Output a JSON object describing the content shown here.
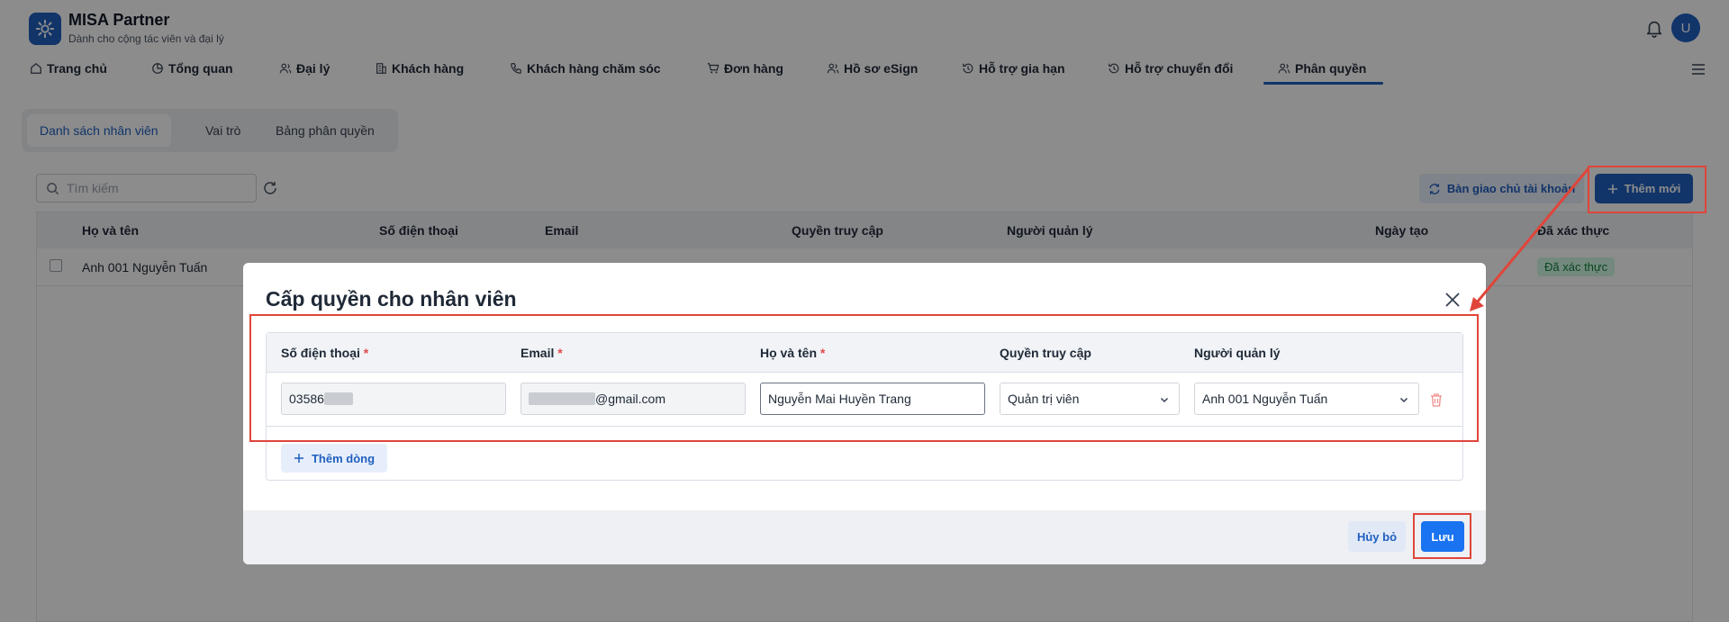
{
  "app": {
    "title": "MISA Partner",
    "subtitle": "Dành cho cộng tác viên và đại lý",
    "avatar_letter": "U"
  },
  "nav": {
    "items": [
      {
        "label": "Trang chủ",
        "icon": "home-icon"
      },
      {
        "label": "Tổng quan",
        "icon": "pie-chart-icon"
      },
      {
        "label": "Đại lý",
        "icon": "users-icon"
      },
      {
        "label": "Khách hàng",
        "icon": "building-icon"
      },
      {
        "label": "Khách hàng chăm sóc",
        "icon": "phone-icon"
      },
      {
        "label": "Đơn hàng",
        "icon": "cart-icon"
      },
      {
        "label": "Hồ sơ eSign",
        "icon": "users-icon"
      },
      {
        "label": "Hỗ trợ gia hạn",
        "icon": "history-icon"
      },
      {
        "label": "Hỗ trợ chuyển đổi",
        "icon": "history-icon"
      },
      {
        "label": "Phân quyền",
        "icon": "users-icon"
      }
    ],
    "active": "Phân quyền"
  },
  "subtabs": [
    "Danh sách nhân viên",
    "Vai trò",
    "Bảng phân quyền"
  ],
  "toolbar": {
    "search_placeholder": "Tìm kiếm",
    "handover_label": "Bàn giao chủ tài khoản",
    "add_new_label": "Thêm mới"
  },
  "table": {
    "columns": [
      "Họ và tên",
      "Số điện thoại",
      "Email",
      "Quyền truy cập",
      "Người quản lý",
      "Ngày tạo",
      "Đã xác thực"
    ],
    "rows": [
      {
        "name": "Anh 001 Nguyễn Tuấn",
        "status": "Đã xác thực"
      }
    ]
  },
  "modal": {
    "title": "Cấp quyền cho nhân viên",
    "columns": {
      "phone": "Số điện thoại",
      "email": "Email",
      "fullname": "Họ và tên",
      "access": "Quyền truy cập",
      "manager": "Người quản lý",
      "required_mark": "*"
    },
    "row": {
      "phone_prefix": "03586",
      "email_suffix": "@gmail.com",
      "fullname": "Nguyễn Mai Huyền Trang",
      "access": "Quản trị viên",
      "manager": "Anh 001 Nguyễn Tuấn"
    },
    "add_row_label": "Thêm dòng",
    "cancel_label": "Hủy bỏ",
    "save_label": "Lưu"
  },
  "colors": {
    "primary": "#1f5fbf",
    "save_button": "#1a73f0",
    "annotation_red": "#e0453a",
    "verified_green": "#15803d"
  }
}
